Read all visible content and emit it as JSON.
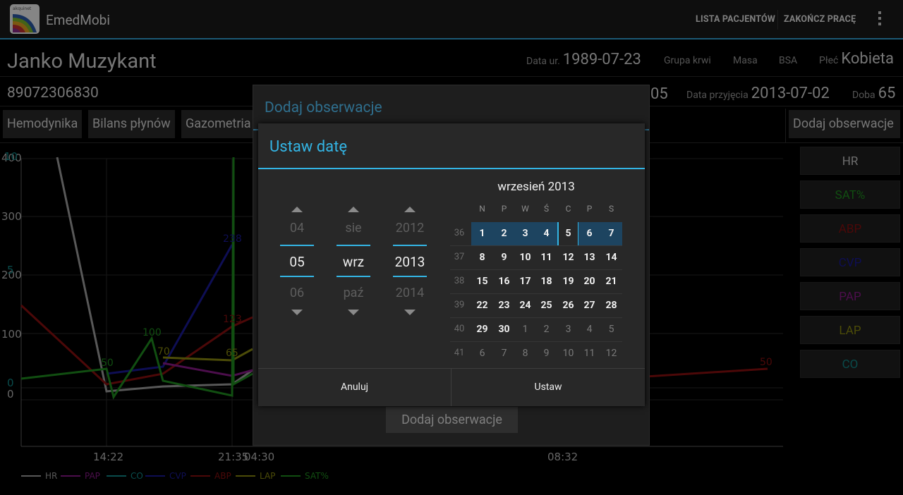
{
  "app": {
    "title": "EmedMobi",
    "icon_text": "akquinet"
  },
  "actionbar": {
    "patients_label": "LISTA PACJENTÓW",
    "finish_label": "ZAKOŃCZ PRACĘ"
  },
  "patient": {
    "name": "Janko Muzykant",
    "id": "89072306830",
    "dob_label": "Data ur.",
    "dob": "1989-07-23",
    "blood_label": "Grupa krwi",
    "mass_label": "Masa",
    "bsa_label": "BSA",
    "sex_label": "Płeć",
    "sex": "Kobieta",
    "partial_value": "05",
    "admission_label": "Data przyjęcia",
    "admission": "2013-07-02",
    "day_label": "Doba",
    "day": "65"
  },
  "tabs": [
    "Hemodynika",
    "Bilans płynów",
    "Gazometria"
  ],
  "add_observation_button": "Dodaj obserwacje",
  "params": [
    {
      "label": "HR",
      "color": "#c8c8c8"
    },
    {
      "label": "SAT%",
      "color": "#1f8f1f"
    },
    {
      "label": "ABP",
      "color": "#8a1010"
    },
    {
      "label": "CVP",
      "color": "#1a1a9a"
    },
    {
      "label": "PAP",
      "color": "#8a1a8a"
    },
    {
      "label": "LAP",
      "color": "#8a8a10"
    },
    {
      "label": "CO",
      "color": "#118a8a"
    }
  ],
  "chart": {
    "y_ticks": [
      "400",
      "300",
      "200",
      "100",
      "0"
    ],
    "extra_y_labels": [
      "10",
      "5",
      "0"
    ],
    "x_ticks": [
      "14:22",
      "21:35",
      "04:30",
      "08:32"
    ],
    "point_labels": [
      "50",
      "100",
      "70",
      "238",
      "123",
      "65",
      "50"
    ],
    "legend": [
      "HR",
      "PAP",
      "CO",
      "CVP",
      "ABP",
      "LAP",
      "SAT%"
    ]
  },
  "outer_dialog": {
    "title": "Dodaj obserwacje",
    "add_button": "Dodaj obserwacje"
  },
  "date_dialog": {
    "title": "Ustaw datę",
    "day_prev": "04",
    "day": "05",
    "day_next": "06",
    "month_prev": "sie",
    "month": "wrz",
    "month_next": "paź",
    "year_prev": "2012",
    "year": "2013",
    "year_next": "2014",
    "calendar_title": "wrzesień 2013",
    "weekdays": [
      "N",
      "P",
      "W",
      "Ś",
      "C",
      "P",
      "S"
    ],
    "weeks": [
      {
        "no": "36",
        "days": [
          "1",
          "2",
          "3",
          "4",
          "5",
          "6",
          "7"
        ]
      },
      {
        "no": "37",
        "days": [
          "8",
          "9",
          "10",
          "11",
          "12",
          "13",
          "14"
        ]
      },
      {
        "no": "38",
        "days": [
          "15",
          "16",
          "17",
          "18",
          "19",
          "20",
          "21"
        ]
      },
      {
        "no": "39",
        "days": [
          "22",
          "23",
          "24",
          "25",
          "26",
          "27",
          "28"
        ]
      },
      {
        "no": "40",
        "days": [
          "29",
          "30",
          "1",
          "2",
          "3",
          "4",
          "5"
        ]
      },
      {
        "no": "41",
        "days": [
          "6",
          "7",
          "8",
          "9",
          "10",
          "11",
          "12"
        ]
      }
    ],
    "cancel_label": "Anuluj",
    "set_label": "Ustaw"
  }
}
